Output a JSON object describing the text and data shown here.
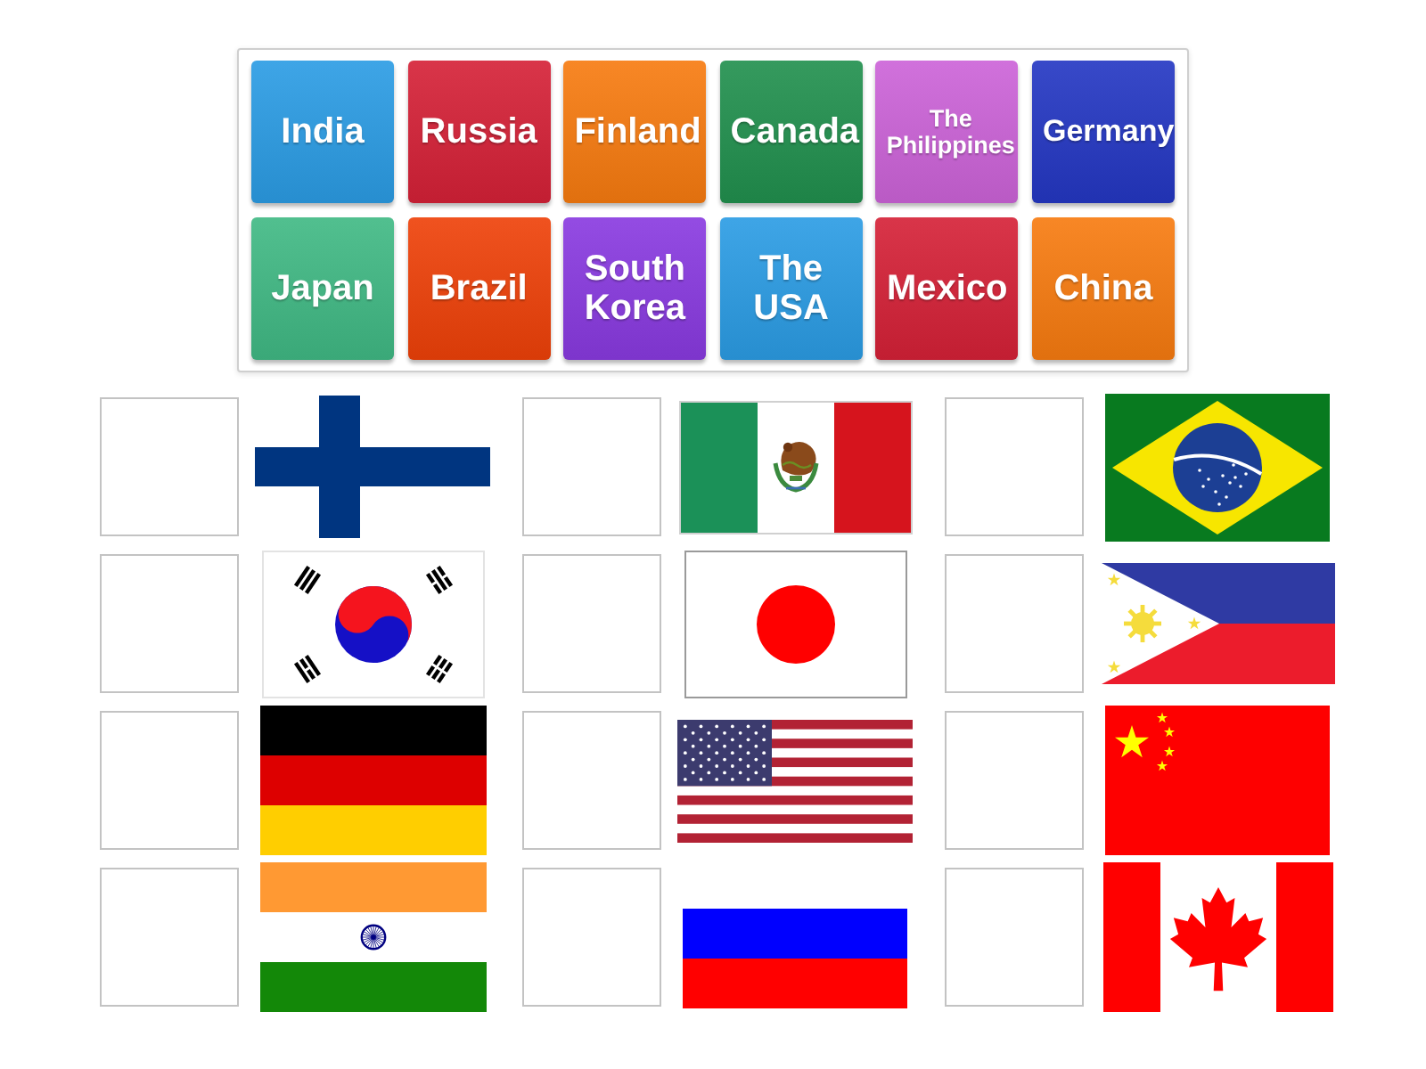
{
  "tiles": [
    {
      "label": "India",
      "color": "#2b9ce4"
    },
    {
      "label": "Russia",
      "color": "#d52137"
    },
    {
      "label": "Finland",
      "color": "#f77b10"
    },
    {
      "label": "Canada",
      "color": "#21904e"
    },
    {
      "label": "The Philippines",
      "color": "#cc63d8"
    },
    {
      "label": "Germany",
      "color": "#2437c3"
    },
    {
      "label": "Japan",
      "color": "#40b984"
    },
    {
      "label": "Brazil",
      "color": "#ee4109"
    },
    {
      "label": "South Korea",
      "color": "#893ae0"
    },
    {
      "label": "The USA",
      "color": "#2b9ce4"
    },
    {
      "label": "Mexico",
      "color": "#d52137"
    },
    {
      "label": "China",
      "color": "#f77b10"
    }
  ],
  "targets": [
    {
      "kind": "finland"
    },
    {
      "kind": "mexico"
    },
    {
      "kind": "brazil"
    },
    {
      "kind": "south-korea"
    },
    {
      "kind": "japan"
    },
    {
      "kind": "philippines"
    },
    {
      "kind": "germany"
    },
    {
      "kind": "usa"
    },
    {
      "kind": "china"
    },
    {
      "kind": "india"
    },
    {
      "kind": "russia"
    },
    {
      "kind": "canada"
    }
  ]
}
